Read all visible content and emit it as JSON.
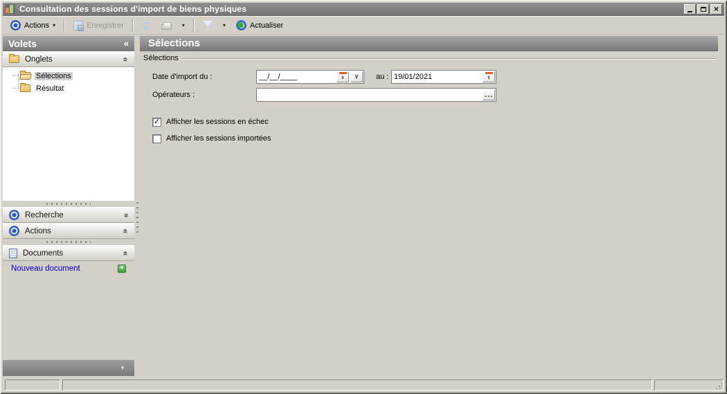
{
  "window": {
    "title": "Consultation des sessions d'import de biens physiques"
  },
  "toolbar": {
    "actions_label": "Actions",
    "save_label": "Enregistrer",
    "actualiser_label": "Actualiser"
  },
  "sidebar": {
    "title": "Volets",
    "panels": [
      {
        "label": "Onglets"
      },
      {
        "label": "Recherche"
      },
      {
        "label": "Actions"
      },
      {
        "label": "Documents"
      }
    ],
    "tree": [
      {
        "label": "Sélections",
        "selected": true
      },
      {
        "label": "Résultat",
        "selected": false
      }
    ],
    "documents_link": "Nouveau document"
  },
  "main": {
    "header": "Sélections",
    "groupbox": "Sélections",
    "fields": {
      "date_from_label": "Date d'import du :",
      "date_from_value": "__/__/____",
      "au_label": "au :",
      "date_to_value": "19/01/2021",
      "operators_label": "Opérateurs :",
      "operators_value": ""
    },
    "checkboxes": [
      {
        "label": "Afficher les sessions en échec",
        "checked": true
      },
      {
        "label": "Afficher les sessions importées",
        "checked": false
      }
    ]
  },
  "colors": {
    "window_bg": "#d4d0c8",
    "titlebar": "#7f7f7f",
    "header_gradient_top": "#a7a7a7",
    "header_gradient_bottom": "#797979",
    "link_blue": "#0000cc",
    "date_button_orange": "#dd5f2b",
    "plus_green": "#3f9b3f"
  },
  "icons": {
    "close": "×",
    "dropdown_arrow": "▾",
    "chevrons": "«",
    "collapse_left": "«",
    "down_arrow": "▼",
    "check": "✓",
    "next": "›",
    "prev": "‹",
    "combo_arrow": "∨",
    "ellipsis": "...",
    "plus": "+"
  }
}
